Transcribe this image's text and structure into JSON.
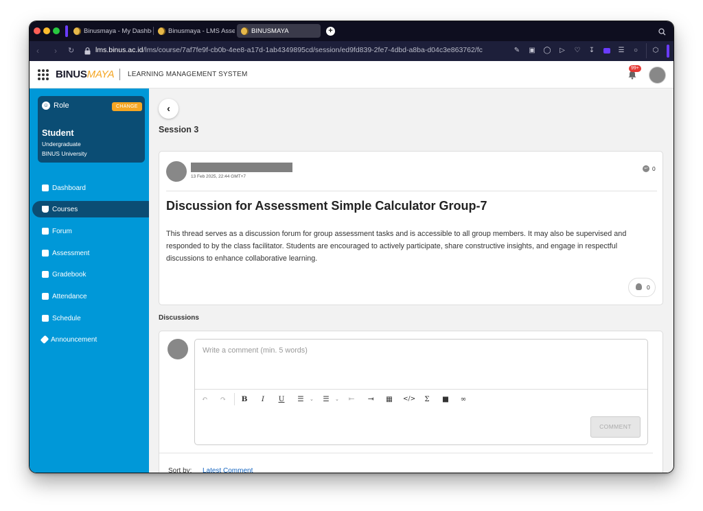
{
  "browser": {
    "tabs": [
      {
        "label": "Binusmaya - My Dashbo"
      },
      {
        "label": "Binusmaya - LMS Asses"
      },
      {
        "label": "BINUSMAYA"
      }
    ],
    "url_host": "lms.binus.ac.id",
    "url_path": "/lms/course/7af7fe9f-cb0b-4ee8-a17d-1ab4349895cd/session/ed9fd839-2fe7-4dbd-a8ba-d04c3e863762/fc"
  },
  "header": {
    "logo_main": "BINUS",
    "logo_accent": "MAYA",
    "title": "LEARNING MANAGEMENT SYSTEM",
    "notification_badge": "99+"
  },
  "sidebar": {
    "role": {
      "label": "Role",
      "change_label": "CHANGE",
      "name": "Student",
      "level": "Undergraduate",
      "institution": "BINUS University"
    },
    "items": [
      {
        "label": "Dashboard",
        "icon": "dashboard-icon"
      },
      {
        "label": "Courses",
        "icon": "courses-icon",
        "active": true
      },
      {
        "label": "Forum",
        "icon": "forum-icon"
      },
      {
        "label": "Assessment",
        "icon": "assessment-icon"
      },
      {
        "label": "Gradebook",
        "icon": "gradebook-icon"
      },
      {
        "label": "Attendance",
        "icon": "attendance-icon"
      },
      {
        "label": "Schedule",
        "icon": "schedule-icon"
      },
      {
        "label": "Announcement",
        "icon": "announcement-icon"
      }
    ]
  },
  "main": {
    "session_title": "Session 3",
    "post": {
      "date": "13 Feb 2025, 22:44 GMT+7",
      "reply_count": "0",
      "title": "Discussion for Assessment Simple Calculator Group-7",
      "body": "This thread serves as a discussion forum for group assessment tasks and is accessible to all group members. It may also be supervised and responded to by the class facilitator. Students are encouraged to actively participate, share constructive insights, and engage in respectful discussions to enhance collaborative learning.",
      "like_count": "0"
    },
    "discussions": {
      "label": "Discussions",
      "placeholder": "Write a comment (min. 5 words)",
      "comment_button": "COMMENT",
      "sort_label": "Sort by:",
      "sort_value": "Latest Comment"
    }
  }
}
